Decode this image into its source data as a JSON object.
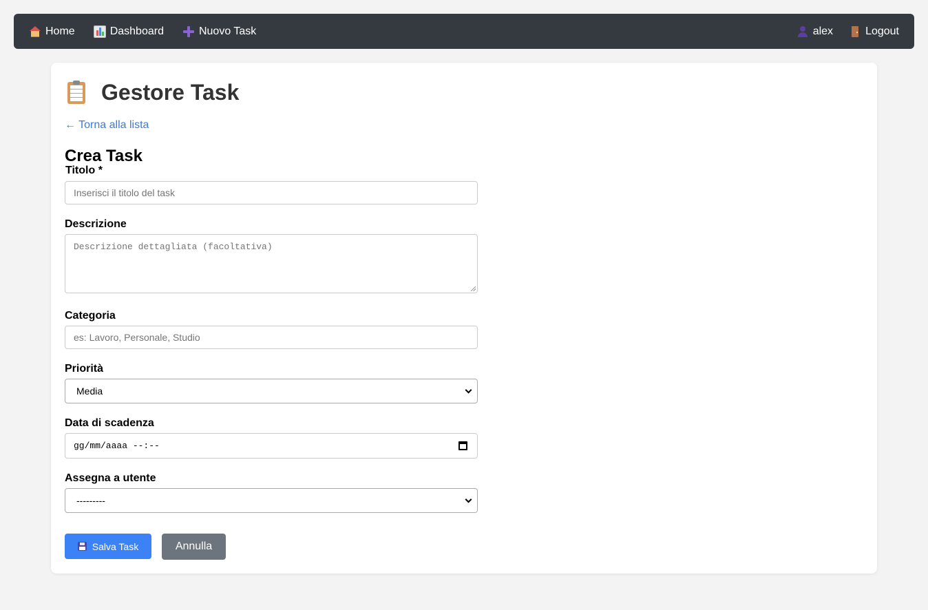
{
  "nav": {
    "home_label": "Home",
    "dashboard_label": "Dashboard",
    "new_task_label": "Nuovo Task",
    "user_label": "alex",
    "logout_label": "Logout"
  },
  "page": {
    "title": "Gestore Task",
    "back_link": "← Torna alla lista",
    "form_heading": "Crea Task"
  },
  "form": {
    "title_label": "Titolo *",
    "title_placeholder": "Inserisci il titolo del task",
    "description_label": "Descrizione",
    "description_placeholder": "Descrizione dettagliata (facoltativa)",
    "category_label": "Categoria",
    "category_placeholder": "es: Lavoro, Personale, Studio",
    "priority_label": "Priorità",
    "priority_value": "Media",
    "due_date_label": "Data di scadenza",
    "due_date_placeholder": "gg/mm/aaaa --:--",
    "assign_label": "Assegna a utente",
    "assign_value": "---------",
    "save_label": "Salva Task",
    "cancel_label": "Annulla"
  },
  "colors": {
    "navbar": "#343a40",
    "link": "#3a7bd5",
    "primary_button": "#3b82f6",
    "secondary_button": "#6c757d"
  }
}
